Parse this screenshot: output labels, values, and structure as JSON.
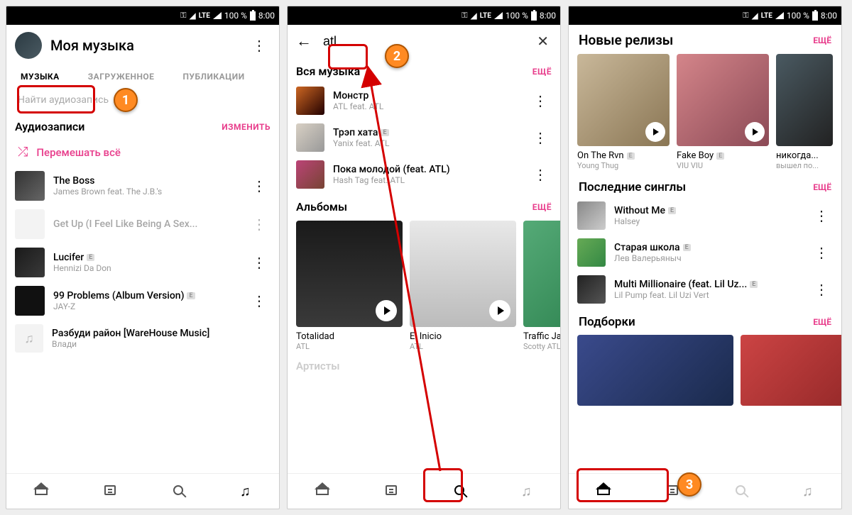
{
  "statusbar": {
    "lte": "LTE",
    "battery_pct": "100 %",
    "time": "8:00"
  },
  "screen1": {
    "title": "Моя музыка",
    "tabs": [
      "МУЗЫКА",
      "ЗАГРУЖЕННОЕ",
      "ПУБЛИКАЦИИ"
    ],
    "search_placeholder": "Найти аудиозапись",
    "section_audio": "Аудиозаписи",
    "edit_label": "ИЗМЕНИТЬ",
    "shuffle_label": "Перемешать всё",
    "tracks": [
      {
        "title": "The Boss",
        "artist": "James Brown feat. The J.B.'s",
        "e": false
      },
      {
        "title": "Get Up (I Feel Like Being A Sex...",
        "artist": "",
        "e": false,
        "faded": true
      },
      {
        "title": "Lucifer",
        "artist": "Hennizi Da Don",
        "e": true
      },
      {
        "title": "99 Problems (Album Version)",
        "artist": "JAY-Z",
        "e": true
      },
      {
        "title": "Разбуди район [WareHouse Music]",
        "artist": "Влади",
        "e": false,
        "noart": true
      }
    ]
  },
  "screen2": {
    "search_value": "atl",
    "section_all": "Вся музыка",
    "more_label": "ЕЩЁ",
    "tracks": [
      {
        "title": "Монстр",
        "artist": "ATL feat. ATL"
      },
      {
        "title": "Трэп хата",
        "artist": "Yanix feat. ATL",
        "e": true
      },
      {
        "title": "Пока молодой (feat. ATL)",
        "artist": "Hash Tag feat. ATL"
      }
    ],
    "section_albums": "Альбомы",
    "albums": [
      {
        "title": "Totalidad",
        "artist": "ATL"
      },
      {
        "title": "El Inicio",
        "artist": "ATL"
      },
      {
        "title": "Traffic Ja...",
        "artist": "Scotty ATL"
      }
    ],
    "section_artists": "Артисты"
  },
  "screen3": {
    "section_releases": "Новые релизы",
    "more_label": "ЕЩЁ",
    "releases": [
      {
        "title": "On The Rvn",
        "artist": "Young Thug",
        "e": true
      },
      {
        "title": "Fake Boy",
        "artist": "VIU VIU",
        "e": true
      },
      {
        "title": "никогда...",
        "artist": "вышел по..."
      }
    ],
    "section_singles": "Последние синглы",
    "singles": [
      {
        "title": "Without Me",
        "artist": "Halsey",
        "e": true
      },
      {
        "title": "Старая школа",
        "artist": "Лев Валерьяныч",
        "e": true
      },
      {
        "title": "Multi Millionaire (feat. Lil Uz...",
        "artist": "Lil Pump feat. Lil Uzi Vert",
        "e": true
      }
    ],
    "section_picks": "Подборки"
  },
  "annotations": {
    "n1": "1",
    "n2": "2",
    "n3": "3"
  }
}
